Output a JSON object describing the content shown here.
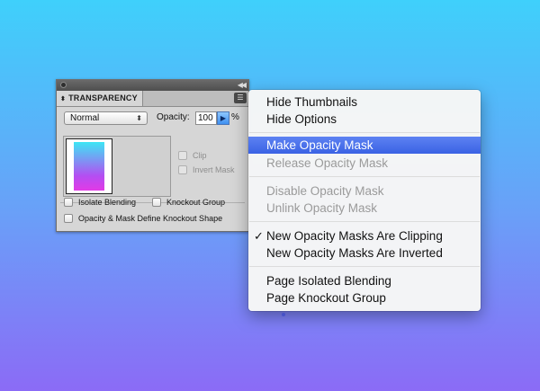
{
  "panel": {
    "tab_title": "TRANSPARENCY",
    "tab_icon": "updown-arrows-icon",
    "blend_mode": "Normal",
    "opacity_label": "Opacity:",
    "opacity_value": "100",
    "opacity_unit": "%",
    "clip_label": "Clip",
    "invert_mask_label": "Invert Mask",
    "isolate_blending_label": "Isolate Blending",
    "knockout_group_label": "Knockout Group",
    "opacity_mask_knockout_label": "Opacity & Mask Define Knockout Shape",
    "thumbnail_colors": [
      "#3de6f4",
      "#e23ae6"
    ]
  },
  "menu": {
    "items": [
      {
        "label": "Hide Thumbnails",
        "enabled": true
      },
      {
        "label": "Hide Options",
        "enabled": true
      },
      {
        "label": "Make Opacity Mask",
        "enabled": true,
        "highlighted": true
      },
      {
        "label": "Release Opacity Mask",
        "enabled": false
      },
      {
        "label": "Disable Opacity Mask",
        "enabled": false
      },
      {
        "label": "Unlink Opacity Mask",
        "enabled": false
      },
      {
        "label": "New Opacity Masks Are Clipping",
        "enabled": true,
        "checked": true
      },
      {
        "label": "New Opacity Masks Are Inverted",
        "enabled": true
      },
      {
        "label": "Page Isolated Blending",
        "enabled": true
      },
      {
        "label": "Page Knockout Group",
        "enabled": true
      }
    ],
    "check_mark": "✓"
  },
  "colors": {
    "menu_highlight": "#3a62e4",
    "background_top": "#3fd0fb",
    "background_bottom": "#8b6bf6"
  }
}
